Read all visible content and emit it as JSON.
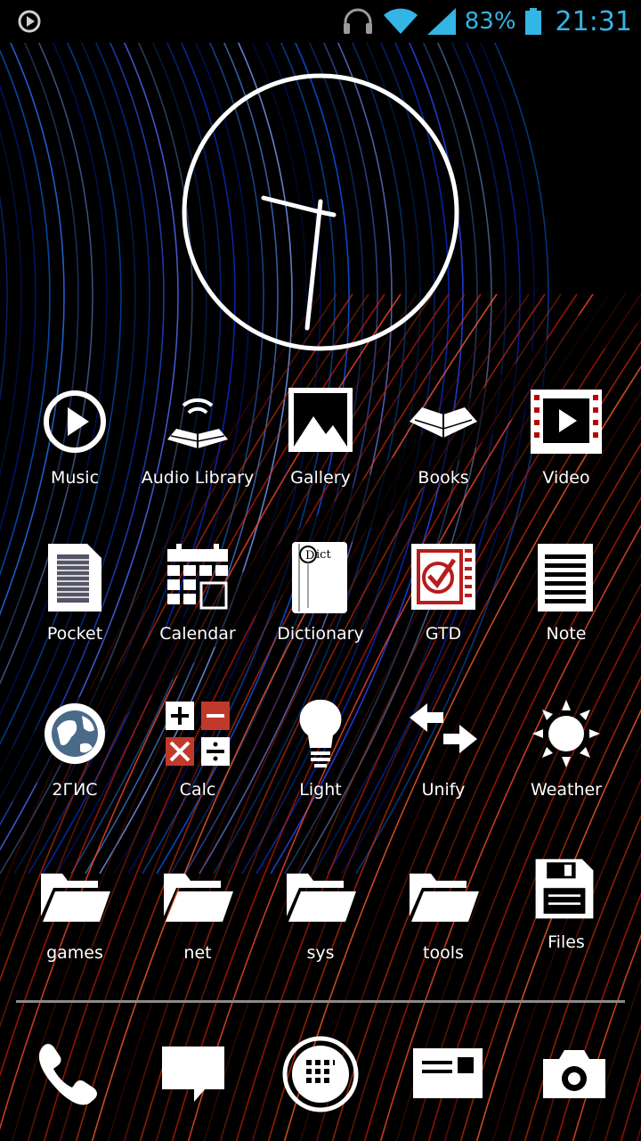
{
  "status_bar": {
    "icons": [
      "play-notification-icon",
      "headset-icon",
      "wifi-icon",
      "signal-icon",
      "battery-icon"
    ],
    "battery_percent": "83%",
    "time": "21:31",
    "accent_color": "#33b5e5"
  },
  "clock": {
    "hour": 9,
    "minute": 31
  },
  "rows": [
    [
      {
        "label": "Music",
        "icon": "play-circle-icon"
      },
      {
        "label": "Audio Library",
        "icon": "audiobook-icon"
      },
      {
        "label": "Gallery",
        "icon": "picture-icon"
      },
      {
        "label": "Books",
        "icon": "open-book-icon"
      },
      {
        "label": "Video",
        "icon": "film-icon"
      }
    ],
    [
      {
        "label": "Pocket",
        "icon": "document-icon"
      },
      {
        "label": "Calendar",
        "icon": "calendar-icon"
      },
      {
        "label": "Dictionary",
        "icon": "dictionary-icon"
      },
      {
        "label": "GTD",
        "icon": "checklist-icon"
      },
      {
        "label": "Note",
        "icon": "notepad-icon"
      }
    ],
    [
      {
        "label": "2ГИС",
        "icon": "globe-icon"
      },
      {
        "label": "Calc",
        "icon": "calculator-icon"
      },
      {
        "label": "Light",
        "icon": "lightbulb-icon"
      },
      {
        "label": "Unify",
        "icon": "arrows-icon"
      },
      {
        "label": "Weather",
        "icon": "sun-icon"
      }
    ],
    [
      {
        "label": "games",
        "icon": "folder-icon"
      },
      {
        "label": "net",
        "icon": "folder-icon"
      },
      {
        "label": "sys",
        "icon": "folder-icon"
      },
      {
        "label": "tools",
        "icon": "folder-icon"
      },
      {
        "label": "Files",
        "icon": "floppy-icon"
      }
    ]
  ],
  "dock": [
    "phone-icon",
    "message-icon",
    "app-drawer-icon",
    "mail-icon",
    "camera-icon"
  ]
}
